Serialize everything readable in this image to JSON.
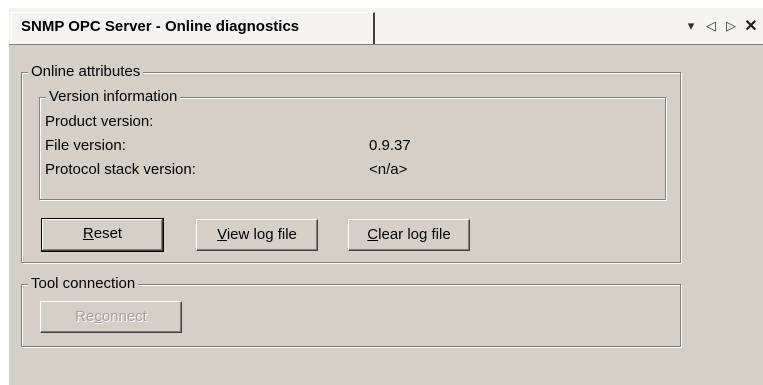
{
  "tab": {
    "title": "SNMP OPC Server - Online diagnostics",
    "controls": {
      "dropdown": "▾",
      "prev": "◁",
      "next": "▷",
      "close": "✕"
    }
  },
  "online_attributes": {
    "legend": "Online attributes",
    "version_info": {
      "legend": "Version information",
      "rows": [
        {
          "label": "Product version:",
          "value": ""
        },
        {
          "label": "File version:",
          "value": "0.9.37"
        },
        {
          "label": "Protocol stack version:",
          "value": "<n/a>"
        }
      ]
    },
    "buttons": {
      "reset": {
        "mnemonic": "R",
        "rest": "eset"
      },
      "view_log": {
        "mnemonic": "V",
        "rest": "iew log file"
      },
      "clear_log": {
        "mnemonic": "C",
        "rest": "lear log file"
      }
    }
  },
  "tool_connection": {
    "legend": "Tool connection",
    "reconnect": {
      "before": "Re",
      "mnemonic": "c",
      "after": "onnect"
    }
  }
}
